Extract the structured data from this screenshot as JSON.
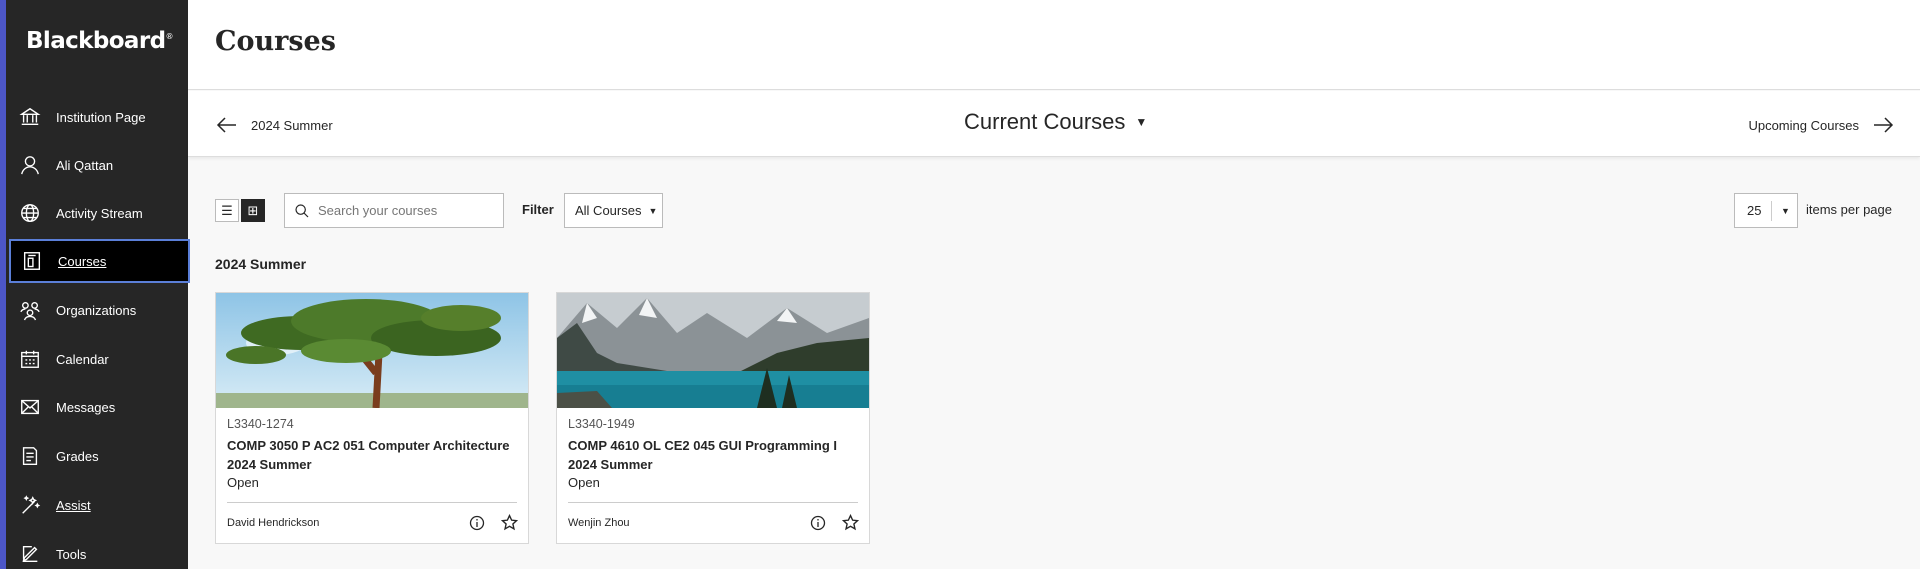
{
  "brand": {
    "name": "Blackboard",
    "mark": "®"
  },
  "sidebar": {
    "items": [
      {
        "label": "Institution Page",
        "icon": "institution-icon"
      },
      {
        "label": "Ali Qattan",
        "icon": "user-icon"
      },
      {
        "label": "Activity Stream",
        "icon": "globe-icon"
      },
      {
        "label": "Courses",
        "icon": "courses-icon"
      },
      {
        "label": "Organizations",
        "icon": "organizations-icon"
      },
      {
        "label": "Calendar",
        "icon": "calendar-icon"
      },
      {
        "label": "Messages",
        "icon": "envelope-icon"
      },
      {
        "label": "Grades",
        "icon": "grades-icon"
      },
      {
        "label": "Assist",
        "icon": "assist-icon"
      },
      {
        "label": "Tools",
        "icon": "tools-icon"
      }
    ],
    "active": "Courses",
    "accent_color": "#4c56c7"
  },
  "header": {
    "title": "Courses"
  },
  "termbar": {
    "previous": "2024 Summer",
    "current": "Current Courses",
    "next": "Upcoming Courses"
  },
  "toolbar": {
    "search_placeholder": "Search your courses",
    "filter_label": "Filter",
    "filter_value": "All Courses",
    "per_page_value": "25",
    "per_page_label": "items per page",
    "view_mode": "grid"
  },
  "term_heading": "2024 Summer",
  "courses": [
    {
      "code": "L3340-1274",
      "name": "COMP 3050 P AC2 051 Computer Architecture 2024 Summer",
      "status": "Open",
      "instructor": "David Hendrickson",
      "image": "tree-photo"
    },
    {
      "code": "L3340-1949",
      "name": "COMP 4610 OL CE2 045 GUI Programming I 2024 Summer",
      "status": "Open",
      "instructor": "Wenjin Zhou",
      "image": "mountain-lake-photo"
    }
  ]
}
